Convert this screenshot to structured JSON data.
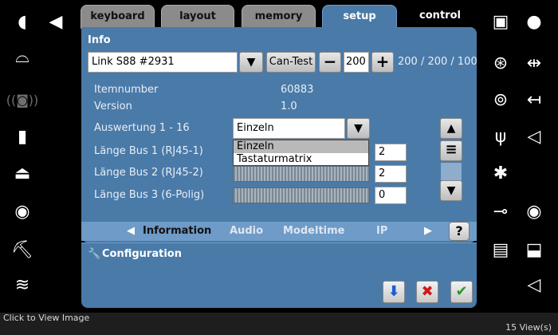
{
  "tabs": [
    {
      "label": "keyboard"
    },
    {
      "label": "layout"
    },
    {
      "label": "memory"
    },
    {
      "label": "setup"
    },
    {
      "label": "control"
    }
  ],
  "info": {
    "section_title": "Info",
    "device_select_value": "Link S88 #2931",
    "can_test_label": "Can-Test",
    "stepper_value": "200",
    "stepper_summary": "200 / 200 / 100",
    "rows": [
      {
        "label": "Itemnumber",
        "value": "60883"
      },
      {
        "label": "Version",
        "value": "1.0"
      }
    ],
    "auswertung_label": "Auswertung 1 - 16",
    "auswertung_value": "Einzeln",
    "dropdown_options": [
      "Einzeln",
      "Tastaturmatrix"
    ],
    "bus_rows": [
      {
        "label": "Länge Bus 1 (RJ45-1)",
        "value": "2"
      },
      {
        "label": "Länge Bus 2 (RJ45-2)",
        "value": "2"
      },
      {
        "label": "Länge Bus 3 (6-Polig)",
        "value": "0"
      }
    ]
  },
  "infobar": {
    "items": [
      "Information",
      "Audio",
      "Modeltime",
      "IP"
    ],
    "help_label": "?"
  },
  "configuration": {
    "title": "Configuration"
  },
  "footer": {
    "left_text": "Click to View Image",
    "right_text": "15 View(s)"
  },
  "colors": {
    "panel": "#4a7aa8",
    "infobar": "#6e9bc8",
    "tab_active": "#4a7aa8"
  }
}
